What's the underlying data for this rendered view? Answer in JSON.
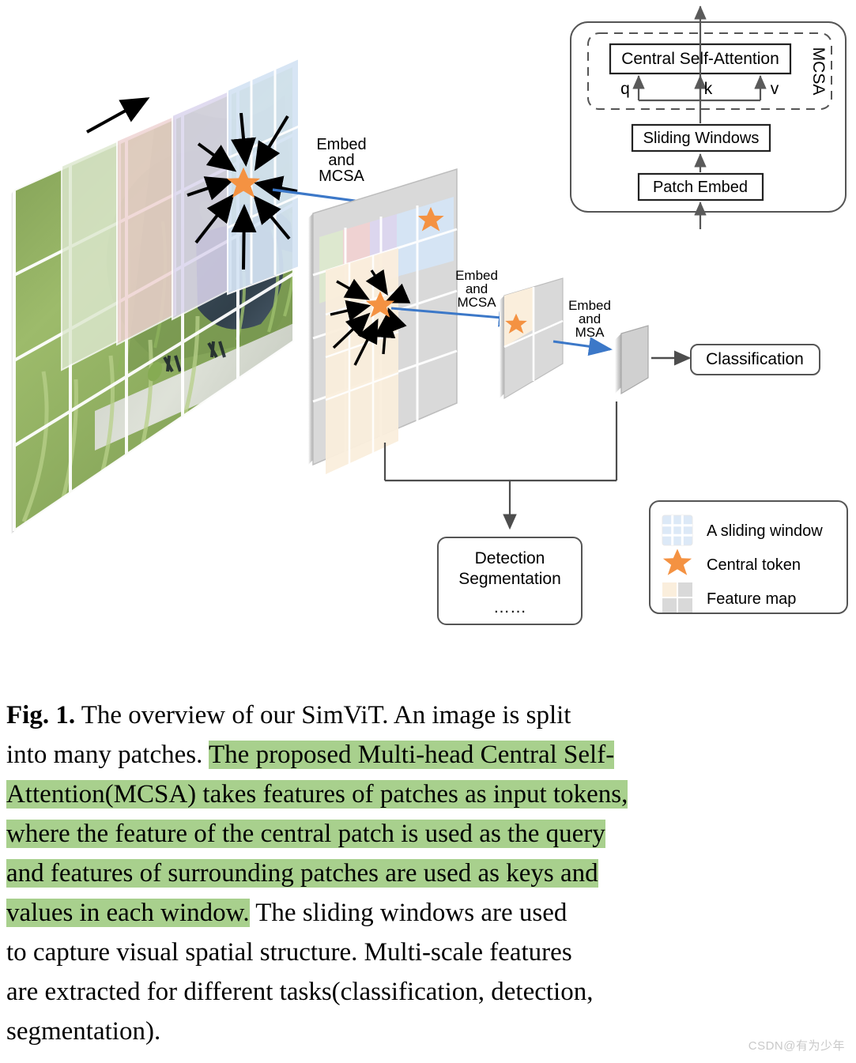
{
  "figure": {
    "arrow_top_left": "sliding-direction-arrow",
    "labels": {
      "embed_mcsa_1": [
        "Embed",
        "and",
        "MCSA"
      ],
      "embed_mcsa_2": [
        "Embed",
        "and",
        "MCSA"
      ],
      "embed_msa": [
        "Embed",
        "and",
        "MSA"
      ]
    },
    "boxes": {
      "classification": "Classification",
      "detection_line1": "Detection",
      "detection_line2": "Segmentation",
      "detection_line3": "……"
    },
    "mcsa_block": {
      "group_label": "MCSA",
      "central_self_attention": "Central Self-Attention",
      "q": "q",
      "k": "k",
      "v": "v",
      "sliding_windows": "Sliding Windows",
      "patch_embed": "Patch Embed"
    },
    "legend": {
      "items": [
        {
          "swatch": "sliding-window-swatch",
          "label": "A sliding window"
        },
        {
          "swatch": "central-token-star",
          "label": "Central token"
        },
        {
          "swatch": "feature-map-swatch",
          "label": "Feature map"
        }
      ]
    },
    "colors": {
      "star": "#F49242",
      "sliding_window_fill": "#DCE9F7",
      "feature_map_fill": "#FAEEDC",
      "feature_map_gray": "#D9D9D9",
      "blue_arrow": "#3C78C8",
      "window_green": "#DDE8CF",
      "window_pink": "#EFD2D2",
      "window_purple": "#DCD6EE",
      "window_blue": "#D5E4F4",
      "outline": "#555555"
    }
  },
  "caption": {
    "fig_label": "Fig. 1.",
    "pre_text": " The overview of our SimViT. An image is split into many patches. ",
    "highlighted": "The proposed Multi-head Central Self-Attention(MCSA) takes features of patches as input tokens, where the feature of the central patch is used as the query and features of surrounding patches are used as keys and values in each window.",
    "post_text": " The sliding windows are used to capture visual spatial structure. Multi-scale features are extracted for different tasks(classification, detection, segmentation).",
    "lines": [
      {
        "id": "l1",
        "segments": [
          {
            "t": "Fig. 1.",
            "style": "bold"
          },
          {
            "t": " The overview of our SimViT. An image is split",
            "style": "plain"
          }
        ]
      },
      {
        "id": "l2",
        "segments": [
          {
            "t": "into many patches. ",
            "style": "plain"
          },
          {
            "t": "The proposed Multi-head Central Self-",
            "style": "hl"
          }
        ]
      },
      {
        "id": "l3",
        "segments": [
          {
            "t": "Attention(MCSA) takes features of patches as input tokens,",
            "style": "hl"
          }
        ]
      },
      {
        "id": "l4",
        "segments": [
          {
            "t": "where the feature of the central patch is used as the query",
            "style": "hl"
          }
        ]
      },
      {
        "id": "l5",
        "segments": [
          {
            "t": "and features of surrounding patches are used as keys and",
            "style": "hl"
          }
        ]
      },
      {
        "id": "l6",
        "segments": [
          {
            "t": "values in each window.",
            "style": "hl"
          },
          {
            "t": " The sliding windows are used",
            "style": "plain"
          }
        ]
      },
      {
        "id": "l7",
        "segments": [
          {
            "t": "to capture visual spatial structure. Multi-scale features",
            "style": "plain"
          }
        ]
      },
      {
        "id": "l8",
        "segments": [
          {
            "t": "are extracted for different tasks(classification, detection,",
            "style": "plain"
          }
        ]
      },
      {
        "id": "l9",
        "segments": [
          {
            "t": "segmentation).",
            "style": "plain"
          }
        ]
      }
    ]
  },
  "watermark": "CSDN@有为少年"
}
